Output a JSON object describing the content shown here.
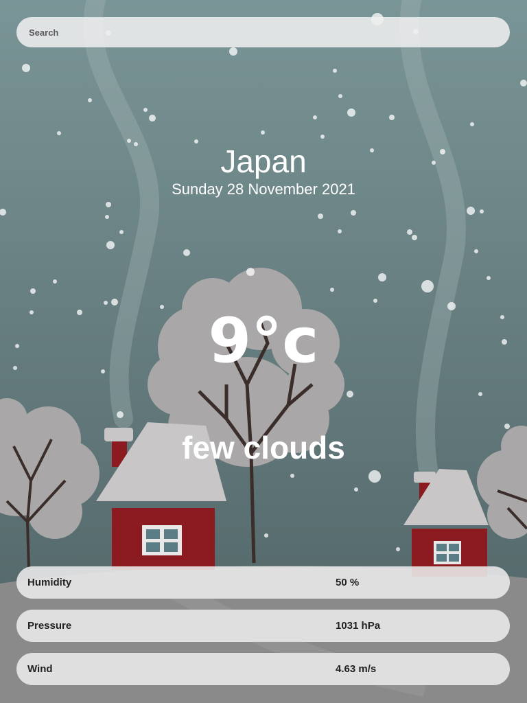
{
  "search": {
    "placeholder": "Search",
    "value": ""
  },
  "weather": {
    "city": "Japan",
    "date": "Sunday 28 November 2021",
    "temperature": "9°c",
    "description": "few clouds"
  },
  "stats": [
    {
      "label": "Humidity",
      "value": "50 %"
    },
    {
      "label": "Pressure",
      "value": "1031 hPa"
    },
    {
      "label": "Wind",
      "value": "4.63 m/s"
    }
  ],
  "colors": {
    "sky_top": "#7a9597",
    "sky_bottom": "#4f6264",
    "snow_ground": "#8a8a8a",
    "tree_foliage": "#a9a7a8",
    "house_wall": "#8b1a21",
    "roof_snow": "#c8c6c6",
    "trunk": "#3b2e2a"
  },
  "illustration": "snowy-village-background"
}
